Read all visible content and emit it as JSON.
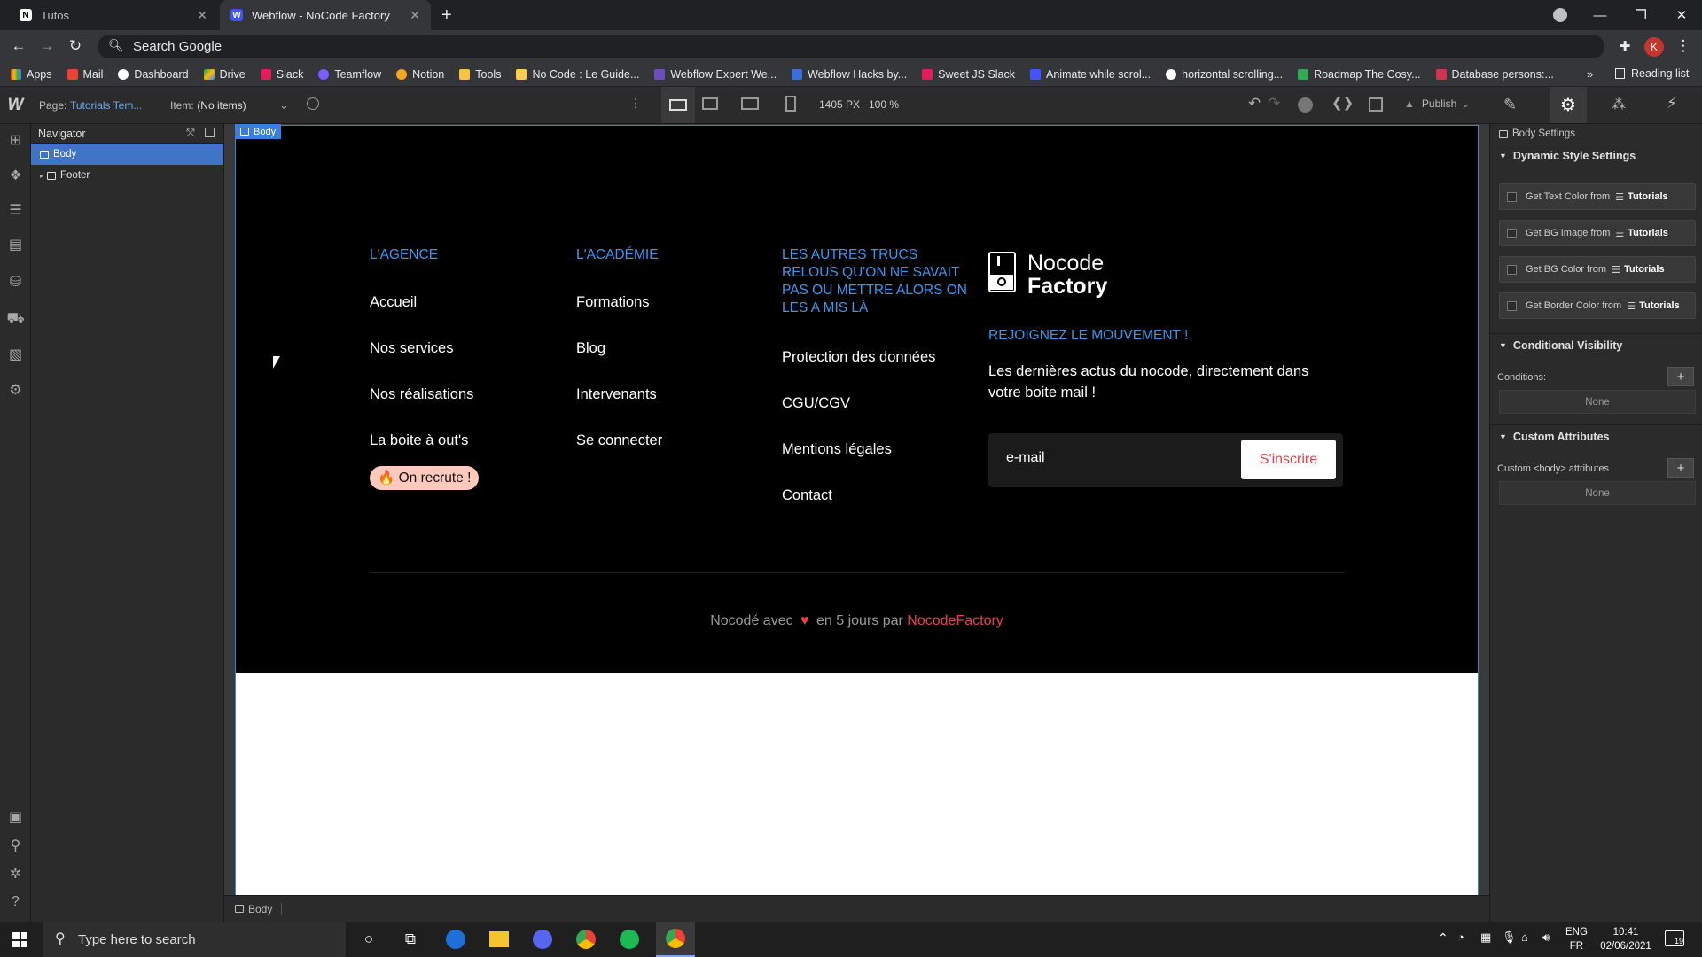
{
  "browser": {
    "tabs": [
      {
        "title": "Tutos",
        "icon": "notion-icon"
      },
      {
        "title": "Webflow - NoCode Factory",
        "icon": "webflow-icon"
      }
    ],
    "omnibox_placeholder": "Search Google",
    "bookmarks": [
      "Apps",
      "Mail",
      "Dashboard",
      "Drive",
      "Slack",
      "Teamflow",
      "Notion",
      "Tools",
      "No Code : Le Guide...",
      "Webflow Expert We...",
      "Webflow Hacks by...",
      "Sweet JS Slack",
      "Animate while scrol...",
      "horizontal scrolling...",
      "Roadmap The Cosy...",
      "Database persons:..."
    ],
    "bookmarks_overflow": "»",
    "reading_list": "Reading list",
    "profile_initial": "K"
  },
  "wf_top": {
    "page_label": "Page:",
    "page_value": "Tutorials Tem...",
    "item_label": "Item:",
    "item_value": "(No items)",
    "width": "1405 PX",
    "zoom": "100 %",
    "publish": "Publish"
  },
  "navigator": {
    "title": "Navigator",
    "items": [
      {
        "label": "Body"
      },
      {
        "label": "Footer"
      }
    ]
  },
  "canvas": {
    "body_tag": "Body",
    "footer": {
      "col1": {
        "heading": "L'AGENCE",
        "links": [
          "Accueil",
          "Nos services",
          "Nos réalisations",
          "La boite à out's"
        ],
        "badge": "🔥 On recrute !"
      },
      "col2": {
        "heading": "L'ACADÉMIE",
        "links": [
          "Formations",
          "Blog",
          "Intervenants",
          "Se connecter"
        ]
      },
      "col3": {
        "heading": "LES AUTRES TRUCS RELOUS QU'ON NE SAVAIT PAS OU METTRE ALORS ON LES A MIS LÀ",
        "links": [
          "Protection des données",
          "CGU/CGV",
          "Mentions légales",
          "Contact"
        ]
      },
      "brand": {
        "line1": "Nocode",
        "line2": "Factory"
      },
      "newsletter": {
        "heading": "REJOIGNEZ LE MOUVEMENT !",
        "text": "Les dernières actus du nocode, directement dans votre boite mail !",
        "placeholder": "e-mail",
        "button": "S'inscrire"
      },
      "credit": {
        "prefix": "Nocodé avec",
        "middle": "en 5 jours par",
        "brand": "NocodeFactory"
      }
    }
  },
  "right_panel": {
    "title": "Body Settings",
    "dynamic_title": "Dynamic Style Settings",
    "dynamic_rows": [
      {
        "label": "Get Text Color from",
        "source": "Tutorials"
      },
      {
        "label": "Get BG Image from",
        "source": "Tutorials"
      },
      {
        "label": "Get BG Color from",
        "source": "Tutorials"
      },
      {
        "label": "Get Border Color from",
        "source": "Tutorials"
      }
    ],
    "visibility_title": "Conditional Visibility",
    "conditions_label": "Conditions:",
    "conditions_value": "None",
    "attributes_title": "Custom Attributes",
    "attributes_label": "Custom <body> attributes",
    "attributes_value": "None"
  },
  "breadcrumb": {
    "item": "Body"
  },
  "taskbar": {
    "search_placeholder": "Type here to search",
    "lang": "ENG",
    "lang2": "FR",
    "time": "10:41",
    "date": "02/06/2021",
    "notifications": "19"
  },
  "colors": {
    "accent_blue": "#3898ec",
    "brand_red": "#e8414b",
    "selection_blue": "#3f74c7"
  }
}
